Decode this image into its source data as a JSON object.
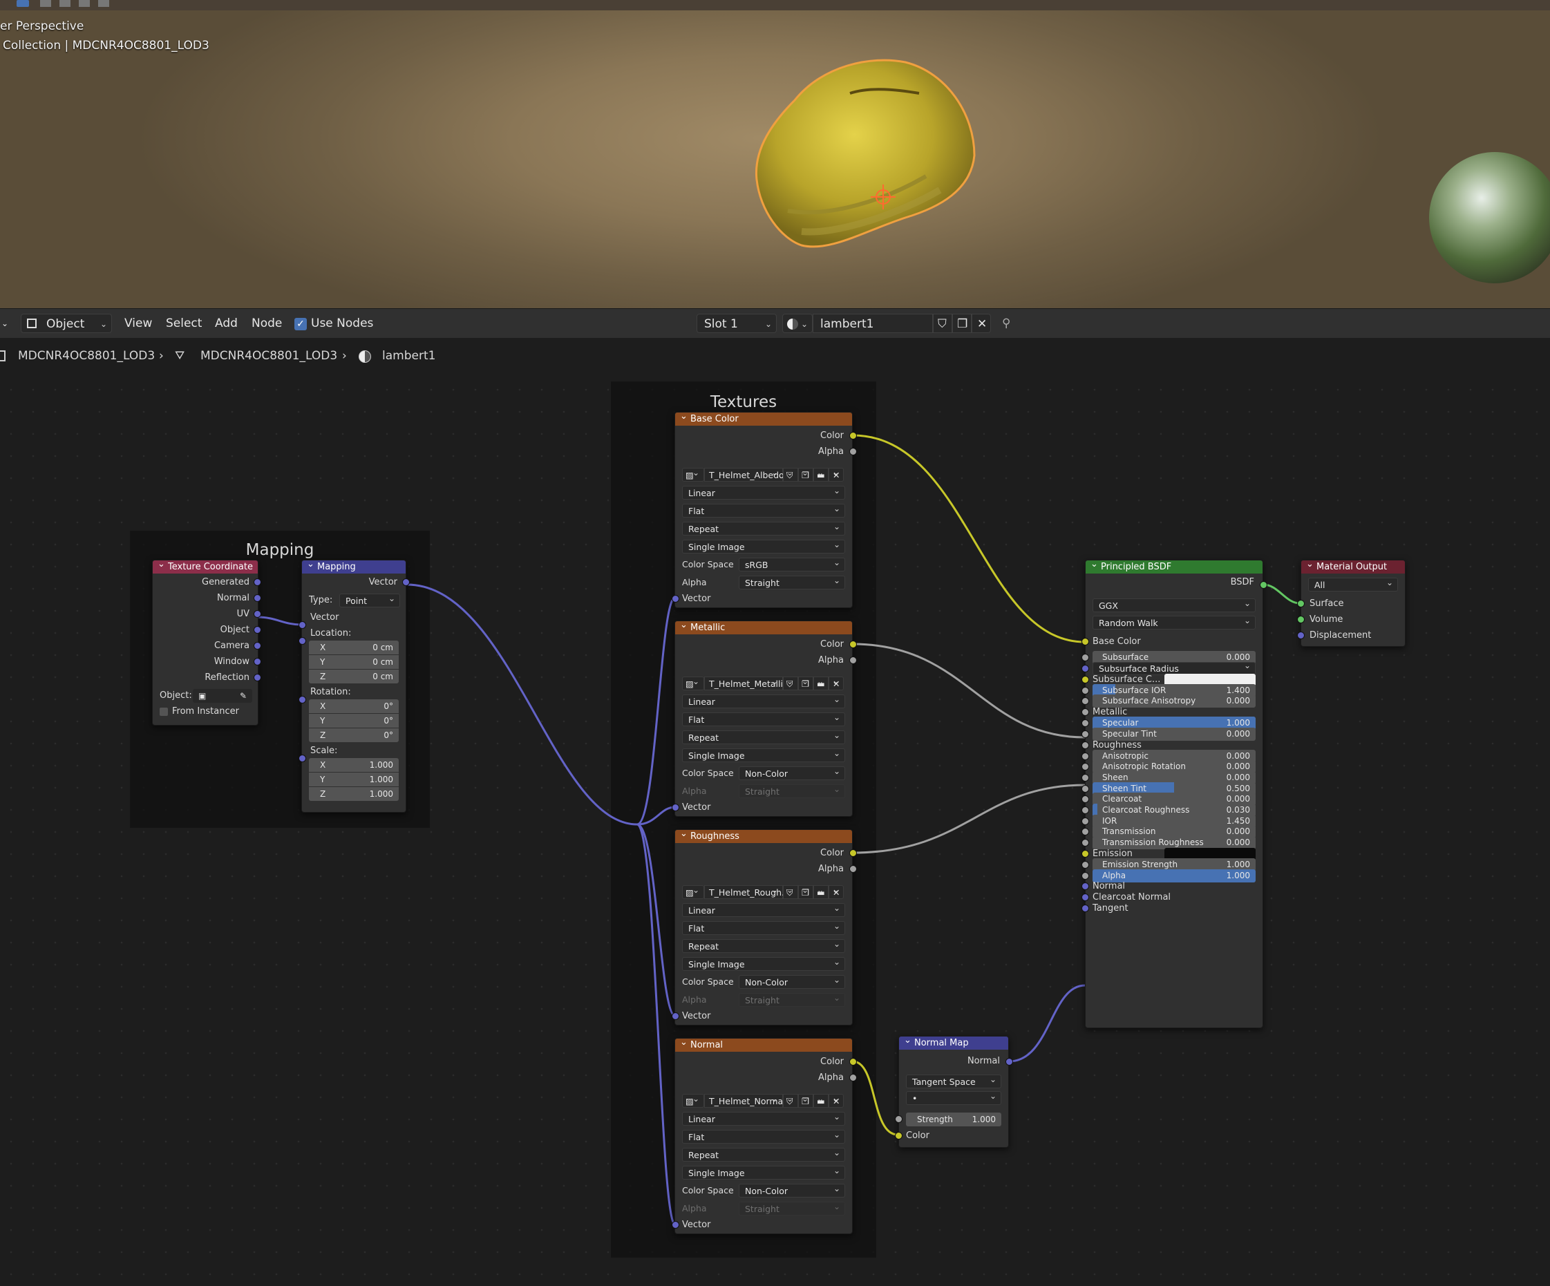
{
  "viewport": {
    "mode_label": "er Perspective",
    "collection_label": "Collection | MDCNR4OC8801_LOD3"
  },
  "header": {
    "mode": "Object",
    "menus": [
      "View",
      "Select",
      "Add",
      "Node"
    ],
    "use_nodes_label": "Use Nodes",
    "use_nodes": true,
    "slot": "Slot 1",
    "material": "lambert1"
  },
  "breadcrumb": {
    "object": "MDCNR4OC8801_LOD3",
    "mesh": "MDCNR4OC8801_LOD3",
    "material": "lambert1"
  },
  "frames": {
    "mapping": "Mapping",
    "textures": "Textures"
  },
  "texcoord": {
    "title": "Texture Coordinate",
    "outputs": [
      "Generated",
      "Normal",
      "UV",
      "Object",
      "Camera",
      "Window",
      "Reflection"
    ],
    "object_label": "Object:",
    "from_instancer": "From Instancer"
  },
  "mapping": {
    "title": "Mapping",
    "out_vector": "Vector",
    "type_label": "Type:",
    "type_value": "Point",
    "in_vector": "Vector",
    "location_label": "Location:",
    "rotation_label": "Rotation:",
    "scale_label": "Scale:",
    "location": [
      {
        "a": "X",
        "v": "0 cm"
      },
      {
        "a": "Y",
        "v": "0 cm"
      },
      {
        "a": "Z",
        "v": "0 cm"
      }
    ],
    "rotation": [
      {
        "a": "X",
        "v": "0°"
      },
      {
        "a": "Y",
        "v": "0°"
      },
      {
        "a": "Z",
        "v": "0°"
      }
    ],
    "scale": [
      {
        "a": "X",
        "v": "1.000"
      },
      {
        "a": "Y",
        "v": "1.000"
      },
      {
        "a": "Z",
        "v": "1.000"
      }
    ]
  },
  "texture_labels": {
    "color_out": "Color",
    "alpha_out": "Alpha",
    "color_space_label": "Color Space",
    "alpha_label": "Alpha",
    "vector_in": "Vector"
  },
  "textures": [
    {
      "title": "Base Color",
      "image": "T_Helmet_Albedo...",
      "interp": "Linear",
      "projection": "Flat",
      "extension": "Repeat",
      "source": "Single Image",
      "color_space": "sRGB",
      "alpha": "Straight"
    },
    {
      "title": "Metallic",
      "image": "T_Helmet_Metalli...",
      "interp": "Linear",
      "projection": "Flat",
      "extension": "Repeat",
      "source": "Single Image",
      "color_space": "Non-Color",
      "alpha": "Straight"
    },
    {
      "title": "Roughness",
      "image": "T_Helmet_Rough...",
      "interp": "Linear",
      "projection": "Flat",
      "extension": "Repeat",
      "source": "Single Image",
      "color_space": "Non-Color",
      "alpha": "Straight"
    },
    {
      "title": "Normal",
      "image": "T_Helmet_Normal...",
      "interp": "Linear",
      "projection": "Flat",
      "extension": "Repeat",
      "source": "Single Image",
      "color_space": "Non-Color",
      "alpha": "Straight"
    }
  ],
  "normal_map": {
    "title": "Normal Map",
    "out": "Normal",
    "space": "Tangent Space",
    "uv_placeholder": "•",
    "strength_label": "Strength",
    "strength": "1.000",
    "color_in": "Color"
  },
  "bsdf": {
    "title": "Principled BSDF",
    "out": "BSDF",
    "distribution": "GGX",
    "subsurface_method": "Random Walk",
    "base_color": "Base Color",
    "subsurface": {
      "label": "Subsurface",
      "value": "0.000",
      "fill": 0
    },
    "subsurface_radius": "Subsurface Radius",
    "subsurface_color": "Subsurface C...",
    "subsurface_ior": {
      "label": "Subsurface IOR",
      "value": "1.400",
      "fill": 0.14
    },
    "subsurface_aniso": {
      "label": "Subsurface Anisotropy",
      "value": "0.000",
      "fill": 0
    },
    "metallic": "Metallic",
    "specular": {
      "label": "Specular",
      "value": "1.000",
      "fill": 1
    },
    "specular_tint": {
      "label": "Specular Tint",
      "value": "0.000",
      "fill": 0
    },
    "roughness": "Roughness",
    "anisotropic": {
      "label": "Anisotropic",
      "value": "0.000",
      "fill": 0
    },
    "aniso_rot": {
      "label": "Anisotropic Rotation",
      "value": "0.000",
      "fill": 0
    },
    "sheen": {
      "label": "Sheen",
      "value": "0.000",
      "fill": 0
    },
    "sheen_tint": {
      "label": "Sheen Tint",
      "value": "0.500",
      "fill": 0.5
    },
    "clearcoat": {
      "label": "Clearcoat",
      "value": "0.000",
      "fill": 0
    },
    "clearcoat_rough": {
      "label": "Clearcoat Roughness",
      "value": "0.030",
      "fill": 0.03
    },
    "ior": {
      "label": "IOR",
      "value": "1.450",
      "fill": 0
    },
    "transmission": {
      "label": "Transmission",
      "value": "0.000",
      "fill": 0
    },
    "transmission_rough": {
      "label": "Transmission Roughness",
      "value": "0.000",
      "fill": 0
    },
    "emission": "Emission",
    "emission_strength": {
      "label": "Emission Strength",
      "value": "1.000",
      "fill": 0
    },
    "alpha": {
      "label": "Alpha",
      "value": "1.000",
      "fill": 1
    },
    "normal": "Normal",
    "clearcoat_normal": "Clearcoat Normal",
    "tangent": "Tangent"
  },
  "output": {
    "title": "Material Output",
    "target": "All",
    "surface": "Surface",
    "volume": "Volume",
    "displacement": "Displacement"
  },
  "colors": {
    "tex_header": "#8c4a1e",
    "bsdf_header": "#2f7a2f",
    "output_header": "#6b2230",
    "texcoord_header": "#8c2e4a",
    "mapping_header": "#3f3f8f",
    "normalmap_header": "#3f3f8f",
    "yellow": "#c7c729",
    "grey": "#a1a1a1",
    "purple": "#6363c7",
    "green": "#63c763",
    "accent": "#4772b3"
  },
  "icons": [
    "object-icon",
    "mesh-icon",
    "material-sphere-icon",
    "shield-icon",
    "duplicate-icon",
    "close-icon",
    "pin-icon",
    "image-icon",
    "folder-icon",
    "eyedropper-icon"
  ]
}
